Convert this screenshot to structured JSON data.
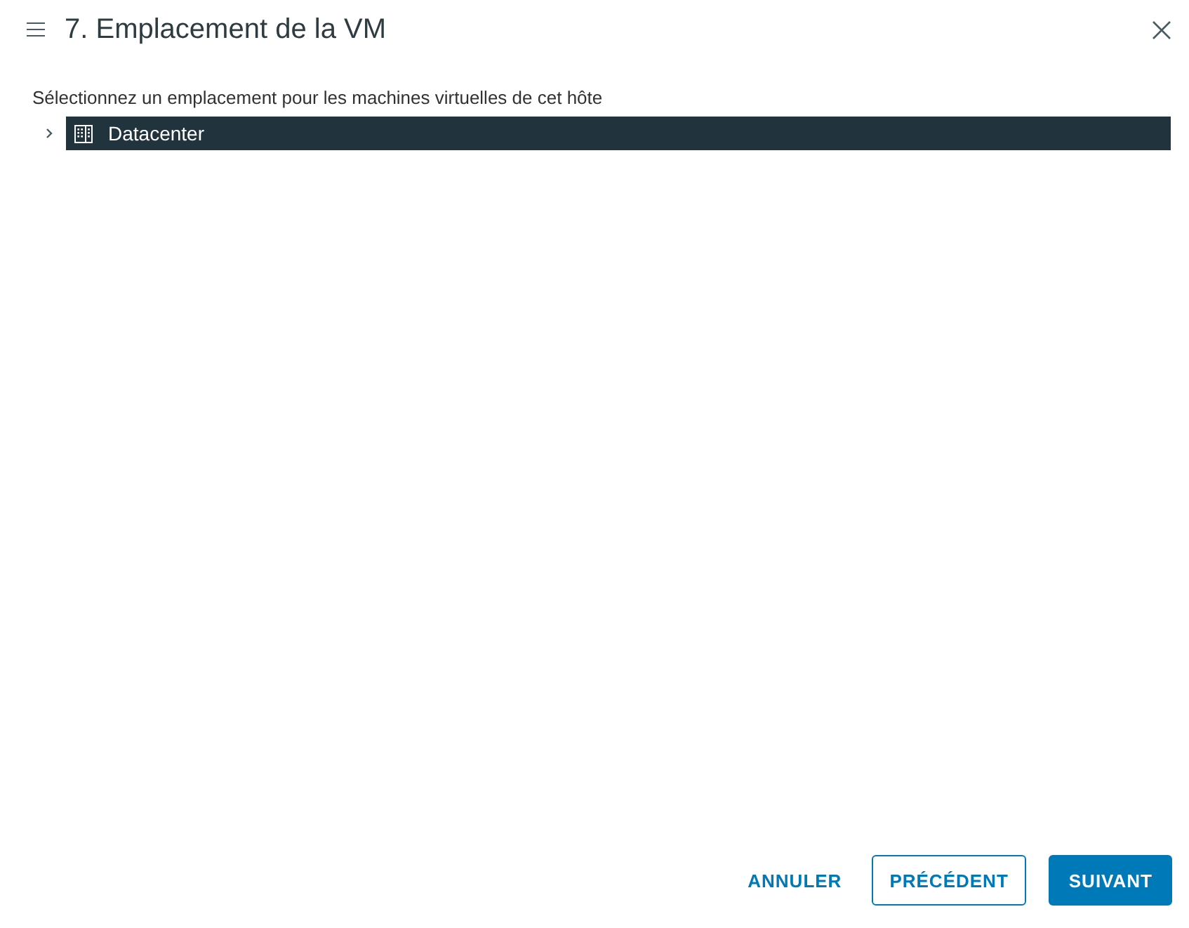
{
  "dialog": {
    "title": "7. Emplacement de la VM",
    "instruction": "Sélectionnez un emplacement pour les machines virtuelles de cet hôte",
    "tree": [
      {
        "label": "Datacenter",
        "kind": "datacenter",
        "selected": true,
        "expanded": false
      }
    ],
    "buttons": [
      {
        "label": "ANNULER",
        "kind": "flat"
      },
      {
        "label": "PRÉCÉDENT",
        "kind": "outline"
      },
      {
        "label": "SUIVANT",
        "kind": "primary"
      }
    ]
  }
}
